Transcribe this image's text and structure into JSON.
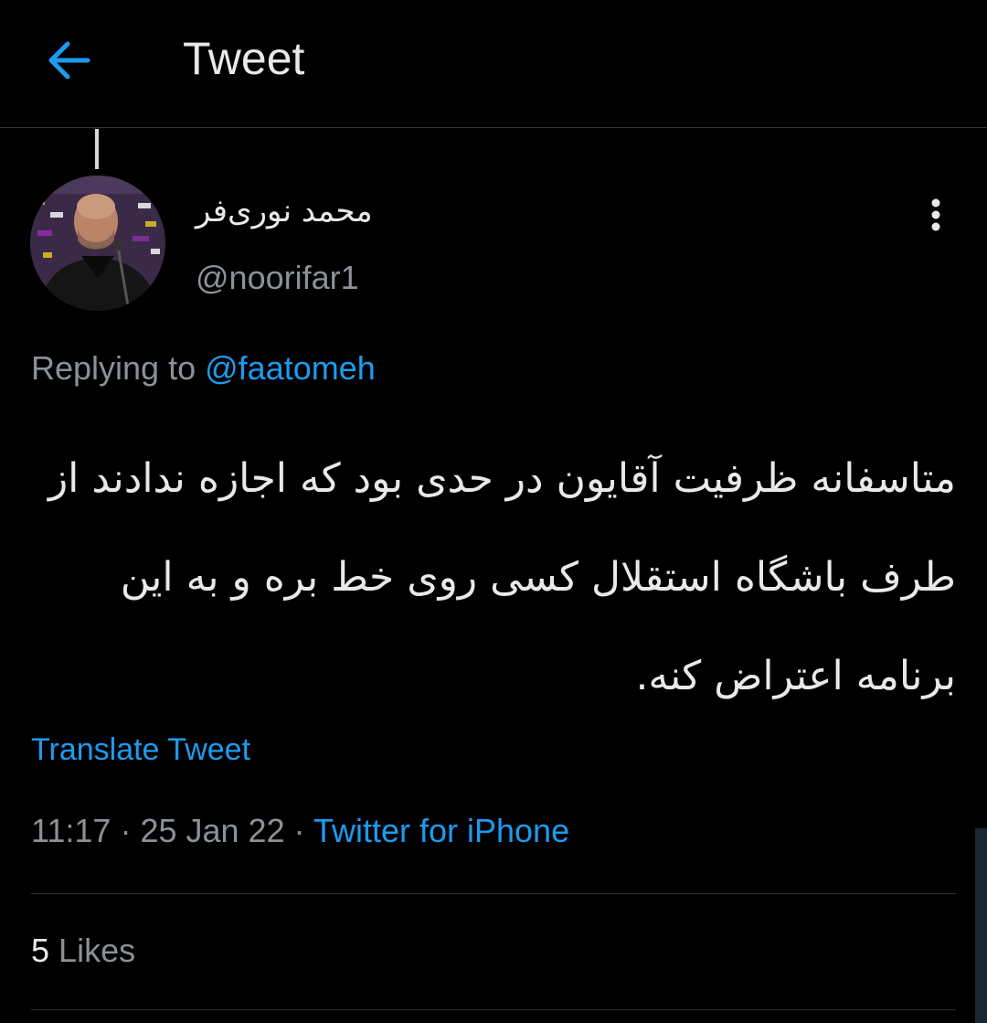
{
  "header": {
    "title": "Tweet",
    "back_icon": "arrow-left-icon",
    "accent_color": "#1d9bf0"
  },
  "tweet": {
    "display_name": "محمد نوری‌فر",
    "handle": "@noorifar1",
    "replying_to_label": "Replying to",
    "replying_to_handle": "@faatomeh",
    "body": "متاسفانه ظرفیت آقایون در حدی بود که اجازه ندادند از طرف باشگاه استقلال کسی روی خط بره و به این برنامه اعتراض کنه.",
    "translate_label": "Translate Tweet",
    "time": "11:17",
    "date": "25 Jan 22",
    "separator": "·",
    "source": "Twitter for iPhone",
    "likes_count": "5",
    "likes_label": "Likes",
    "more_icon": "more-vertical-icon",
    "avatar_icon": "avatar"
  }
}
